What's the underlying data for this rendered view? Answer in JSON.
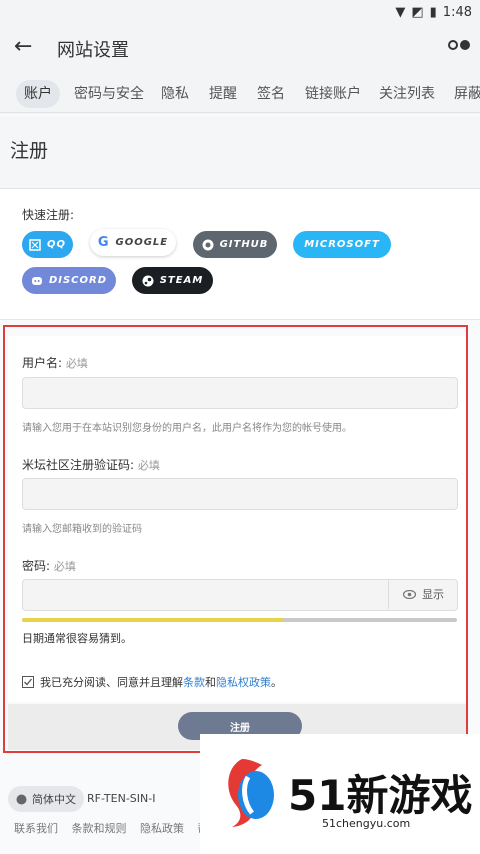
{
  "status_bar": {
    "time": "1:48"
  },
  "app_bar": {
    "title": "网站设置"
  },
  "tabs": [
    {
      "label": "账户",
      "active": true
    },
    {
      "label": "密码与安全",
      "active": false
    },
    {
      "label": "隐私",
      "active": false
    },
    {
      "label": "提醒",
      "active": false
    },
    {
      "label": "签名",
      "active": false
    },
    {
      "label": "链接账户",
      "active": false
    },
    {
      "label": "关注列表",
      "active": false
    },
    {
      "label": "屏蔽",
      "active": false
    }
  ],
  "page": {
    "heading": "注册",
    "quick_register_label": "快速注册:",
    "providers": [
      {
        "label": "QQ",
        "color": "#2ba8f0",
        "text_color": "#ffffff"
      },
      {
        "label": "GOOGLE",
        "color": "#ffffff",
        "text_color": "#444444"
      },
      {
        "label": "GITHUB",
        "color": "#5e6670",
        "text_color": "#ffffff"
      },
      {
        "label": "MICROSOFT",
        "color": "#29b6f6",
        "text_color": "#ffffff"
      },
      {
        "label": "DISCORD",
        "color": "#7289da",
        "text_color": "#ffffff"
      },
      {
        "label": "STEAM",
        "color": "#1b1f24",
        "text_color": "#ffffff"
      }
    ]
  },
  "form": {
    "username": {
      "label": "用户名:",
      "required": "必填",
      "value": "",
      "hint": "请输入您用于在本站识别您身份的用户名，此用户名将作为您的帐号使用。"
    },
    "code": {
      "label": "米坛社区注册验证码:",
      "required": "必填",
      "value": "",
      "hint": "请输入您邮箱收到的验证码"
    },
    "password": {
      "label": "密码:",
      "required": "必填",
      "value": "",
      "show_label": "显示",
      "strength_fraction": 0.6,
      "strength_text": "日期通常很容易猜到。"
    },
    "agree": {
      "prefix": "我已充分阅读、同意并且理解",
      "terms": "条款",
      "and": "和",
      "privacy": "隐私权政策",
      "suffix": "。"
    },
    "submit_label": "注册"
  },
  "footer": {
    "language": "简体中文",
    "region": "RF-TEN-SIN-I",
    "links": [
      "联系我们",
      "条款和规则",
      "隐私政策",
      "帮"
    ]
  },
  "watermark": {
    "number": "51新游戏",
    "domain": "51chengyu.com"
  }
}
